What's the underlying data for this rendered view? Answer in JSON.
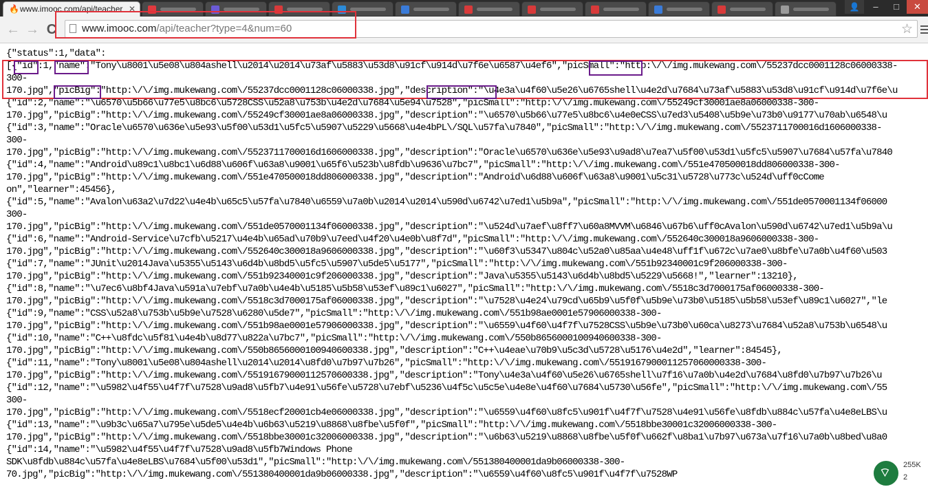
{
  "browser": {
    "active_tab": {
      "title": "www.imooc.com/api/teacher",
      "close_glyph": "✕"
    },
    "background_tabs": [
      {
        "color": "#e0393e"
      },
      {
        "color": "#6b5bd6"
      },
      {
        "color": "#d83a3a"
      },
      {
        "color": "#2b8bd8"
      },
      {
        "color": "#3a7bd8"
      },
      {
        "color": "#d83a3a"
      },
      {
        "color": "#d83a3a"
      },
      {
        "color": "#d83a3a"
      },
      {
        "color": "#3a7bd8"
      },
      {
        "color": "#d83a3a"
      },
      {
        "color": "#9a9a9a"
      }
    ],
    "window_controls": {
      "user": "👤",
      "minimize": "–",
      "maximize": "□",
      "close": "✕"
    },
    "toolbar": {
      "back_icon": "back-arrow-icon",
      "forward_icon": "forward-arrow-icon",
      "reload_icon": "reload-icon",
      "back": "←",
      "forward": "→",
      "reload": "C"
    },
    "url": {
      "host": "www.imooc.com",
      "path": "/api/teacher?type=4&num=60"
    },
    "star": "☆"
  },
  "json_lines": [
    "{\"status\":1,\"data\":",
    "[{\"id\":1,\"name\":\"Tony\\u8001\\u5e08\\u804ashell\\u2014\\u2014\\u73af\\u5883\\u53d8\\u91cf\\u914d\\u7f6e\\u6587\\u4ef6\",\"picSmall\":\"http:\\/\\/img.mukewang.com\\/55237dcc0001128c06000338-",
    "300-",
    "170.jpg\",\"picBig\":\"http:\\/\\/img.mukewang.com\\/55237dcc0001128c06000338.jpg\",\"description\":\"\\u4e3a\\u4f60\\u5e26\\u6765shell\\u4e2d\\u7684\\u73af\\u5883\\u53d8\\u91cf\\u914d\\u7f6e\\u",
    "{\"id\":2,\"name\":\"\\u6570\\u5b66\\u77e5\\u8bc6\\u5728CSS\\u52a8\\u753b\\u4e2d\\u7684\\u5e94\\u7528\",\"picSmall\":\"http:\\/\\/img.mukewang.com\\/55249cf30001ae8a06000338-300-",
    "170.jpg\",\"picBig\":\"http:\\/\\/img.mukewang.com\\/55249cf30001ae8a06000338.jpg\",\"description\":\"\\u6570\\u5b66\\u77e5\\u8bc6\\u4e0eCSS\\u7ed3\\u5408\\u5b9e\\u73b0\\u9177\\u70ab\\u6548\\u",
    "{\"id\":3,\"name\":\"Oracle\\u6570\\u636e\\u5e93\\u5f00\\u53d1\\u5fc5\\u5907\\u5229\\u5668\\u4e4bPL\\/SQL\\u57fa\\u7840\",\"picSmall\":\"http:\\/\\/img.mukewang.com\\/5523711700016d1606000338-",
    "300-",
    "170.jpg\",\"picBig\":\"http:\\/\\/img.mukewang.com\\/5523711700016d1606000338.jpg\",\"description\":\"Oracle\\u6570\\u636e\\u5e93\\u9ad8\\u7ea7\\u5f00\\u53d1\\u5fc5\\u5907\\u7684\\u57fa\\u7840",
    "{\"id\":4,\"name\":\"Android\\u89c1\\u8bc1\\u6d88\\u606f\\u63a8\\u9001\\u65f6\\u523b\\u8fdb\\u9636\\u7bc7\",\"picSmall\":\"http:\\/\\/img.mukewang.com\\/551e470500018dd806000338-300-",
    "170.jpg\",\"picBig\":\"http:\\/\\/img.mukewang.com\\/551e470500018dd806000338.jpg\",\"description\":\"Android\\u6d88\\u606f\\u63a8\\u9001\\u5c31\\u5728\\u773c\\u524d\\uff0cCome",
    "on\",\"learner\":45456},",
    "{\"id\":5,\"name\":\"Avalon\\u63a2\\u7d22\\u4e4b\\u65c5\\u57fa\\u7840\\u6559\\u7a0b\\u2014\\u2014\\u590d\\u6742\\u7ed1\\u5b9a\",\"picSmall\":\"http:\\/\\/img.mukewang.com\\/551de0570001134f06000",
    "300-",
    "170.jpg\",\"picBig\":\"http:\\/\\/img.mukewang.com\\/551de0570001134f06000338.jpg\",\"description\":\"\\u524d\\u7aef\\u8ff7\\u60a8MVVM\\u6846\\u67b6\\uff0cAvalon\\u590d\\u6742\\u7ed1\\u5b9a\\u",
    "{\"id\":6,\"name\":\"Android-Service\\u7cfb\\u5217\\u4e4b\\u65ad\\u70b9\\u7eed\\u4f20\\u4e0b\\u8f7d\",\"picSmall\":\"http:\\/\\/img.mukewang.com\\/552640c300018a9606000338-300-",
    "170.jpg\",\"picBig\":\"http:\\/\\/img.mukewang.com\\/552640c300018a9606000338.jpg\",\"description\":\"\\u60f3\\u5347\\u804c\\u52a0\\u85aa\\u4e48\\uff1f\\u672c\\u7ae0\\u8bfe\\u7a0b\\u4f60\\u503",
    "{\"id\":7,\"name\":\"JUnit\\u2014Java\\u5355\\u5143\\u6d4b\\u8bd5\\u5fc5\\u5907\\u5de5\\u5177\",\"picSmall\":\"http:\\/\\/img.mukewang.com\\/551b92340001c9f206000338-300-",
    "170.jpg\",\"picBig\":\"http:\\/\\/img.mukewang.com\\/551b92340001c9f206000338.jpg\",\"description\":\"Java\\u5355\\u5143\\u6d4b\\u8bd5\\u5229\\u5668!\",\"learner\":13210},",
    "{\"id\":8,\"name\":\"\\u7ec6\\u8bf4Java\\u591a\\u7ebf\\u7a0b\\u4e4b\\u5185\\u5b58\\u53ef\\u89c1\\u6027\",\"picSmall\":\"http:\\/\\/img.mukewang.com\\/5518c3d7000175af06000338-300-",
    "170.jpg\",\"picBig\":\"http:\\/\\/img.mukewang.com\\/5518c3d7000175af06000338.jpg\",\"description\":\"\\u7528\\u4e24\\u79cd\\u65b9\\u5f0f\\u5b9e\\u73b0\\u5185\\u5b58\\u53ef\\u89c1\\u6027\",\"le",
    "{\"id\":9,\"name\":\"CSS\\u52a8\\u753b\\u5b9e\\u7528\\u6280\\u5de7\",\"picSmall\":\"http:\\/\\/img.mukewang.com\\/551b98ae0001e57906000338-300-",
    "170.jpg\",\"picBig\":\"http:\\/\\/img.mukewang.com\\/551b98ae0001e57906000338.jpg\",\"description\":\"\\u6559\\u4f60\\u4f7f\\u7528CSS\\u5b9e\\u73b0\\u60ca\\u8273\\u7684\\u52a8\\u753b\\u6548\\u",
    "{\"id\":10,\"name\":\"C++\\u8fdc\\u5f81\\u4e4b\\u8d77\\u822a\\u7bc7\",\"picSmall\":\"http:\\/\\/img.mukewang.com\\/550b8656000100940600338-300-",
    "170.jpg\",\"picBig\":\"http:\\/\\/img.mukewang.com\\/550b8656000100940600338.jpg\",\"description\":\"C++\\u4eae\\u70b9\\u5c3d\\u5728\\u5176\\u4e2d\",\"learner\":84545},",
    "{\"id\":11,\"name\":\"Tony\\u8001\\u5e08\\u804ashell\\u2014\\u2014\\u8fd0\\u7b97\\u7b26\",\"picSmall\":\"http:\\/\\/img.mukewang.com\\/5519167900011257060000338-300-",
    "170.jpg\",\"picBig\":\"http:\\/\\/img.mukewang.com\\/55191679000112570600338.jpg\",\"description\":\"Tony\\u4e3a\\u4f60\\u5e26\\u6765shell\\u7f16\\u7a0b\\u4e2d\\u7684\\u8fd0\\u7b97\\u7b26\\u",
    "{\"id\":12,\"name\":\"\\u5982\\u4f55\\u4f7f\\u7528\\u9ad8\\u5fb7\\u4e91\\u56fe\\u5728\\u7ebf\\u5236\\u4f5c\\u5c5e\\u4e8e\\u4f60\\u7684\\u5730\\u56fe\",\"picSmall\":\"http:\\/\\/img.mukewang.com\\/55",
    "300-",
    "170.jpg\",\"picBig\":\"http:\\/\\/img.mukewang.com\\/5518ecf20001cb4e06000338.jpg\",\"description\":\"\\u6559\\u4f60\\u8fc5\\u901f\\u4f7f\\u7528\\u4e91\\u56fe\\u8fdb\\u884c\\u57fa\\u4e8eLBS\\u",
    "{\"id\":13,\"name\":\"\\u9b3c\\u65a7\\u795e\\u5de5\\u4e4b\\u6b63\\u5219\\u8868\\u8fbe\\u5f0f\",\"picSmall\":\"http:\\/\\/img.mukewang.com\\/5518bbe30001c32006000338-300-",
    "170.jpg\",\"picBig\":\"http:\\/\\/img.mukewang.com\\/5518bbe30001c32006000338.jpg\",\"description\":\"\\u6b63\\u5219\\u8868\\u8fbe\\u5f0f\\u662f\\u8ba1\\u7b97\\u673a\\u7f16\\u7a0b\\u8bed\\u8a0",
    "{\"id\":14,\"name\":\"\\u5982\\u4f55\\u4f7f\\u7528\\u9ad8\\u5fb7Windows Phone",
    "SDK\\u8fdb\\u884c\\u57fa\\u4e8eLBS\\u7684\\u5f00\\u53d1\",\"picSmall\":\"http:\\/\\/img.mukewang.com\\/551380400001da9b06000338-300-",
    "70.jpg\",\"picBig\":\"http:\\/\\/img.mukewang.com\\/551380400001da9b06000338.jpg\",\"description\":\"\\u6559\\u4f60\\u8fc5\\u901f\\u4f7f\\u7528WP"
  ],
  "tray": {
    "net_up": "255K",
    "net_down": "2"
  }
}
